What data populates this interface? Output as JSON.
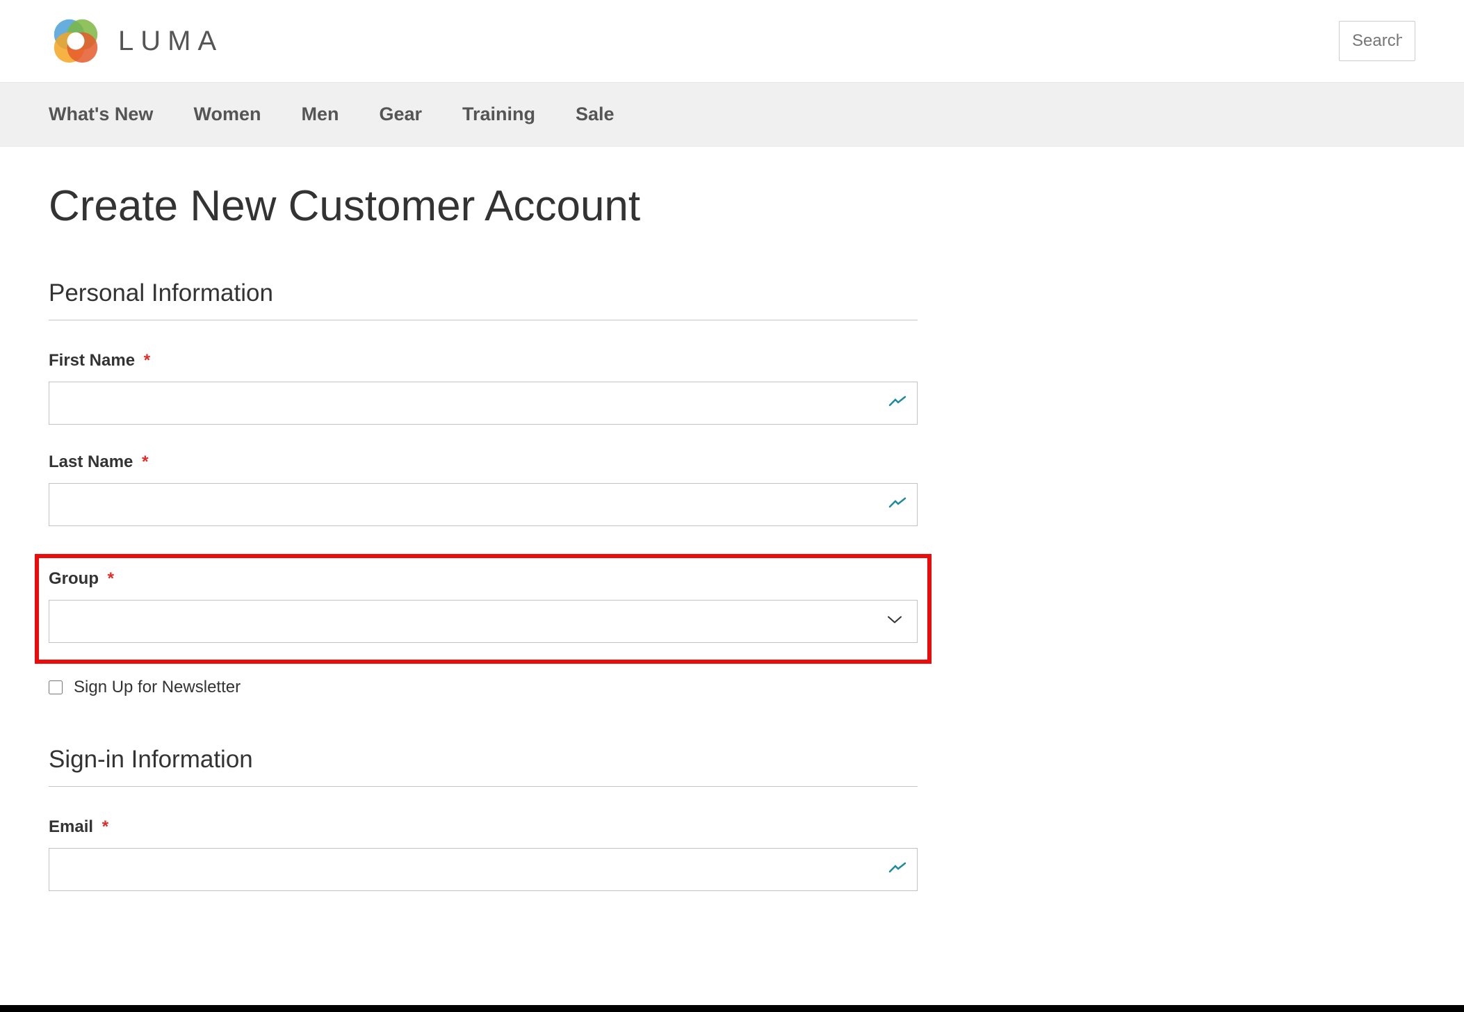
{
  "header": {
    "logo_text": "LUMA",
    "search_placeholder": "Search e"
  },
  "nav": {
    "items": [
      "What's New",
      "Women",
      "Men",
      "Gear",
      "Training",
      "Sale"
    ]
  },
  "page": {
    "title": "Create New Customer Account"
  },
  "form": {
    "personal_legend": "Personal Information",
    "first_name_label": "First Name",
    "last_name_label": "Last Name",
    "group_label": "Group",
    "newsletter_label": "Sign Up for Newsletter",
    "signin_legend": "Sign-in Information",
    "email_label": "Email",
    "required_marker": "*"
  }
}
